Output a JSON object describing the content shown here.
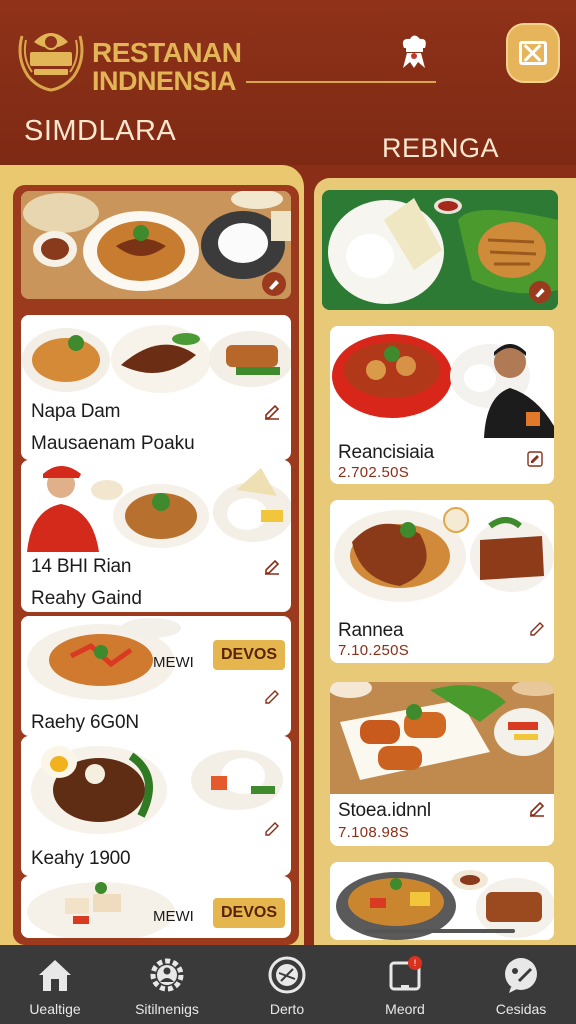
{
  "header": {
    "brand_line1": "RESTANAN",
    "brand_line2": "INDNENSIA",
    "tab_left": "SIMDLARA",
    "tab_right": "REBNGA"
  },
  "left_cards": [
    {
      "name": "Napa Dam",
      "subtitle": "Mausaenam Poaku"
    },
    {
      "name": "14 BHI Rian",
      "subtitle": "Reahy Gaind"
    },
    {
      "name": "Raehy 6G0N",
      "tag_small": "MEWI",
      "button": "DEVOS"
    },
    {
      "name": "Keahy 1900"
    },
    {
      "tag_small": "MEWI",
      "button": "DEVOS"
    }
  ],
  "right_cards": [
    {
      "name": "",
      "price": ""
    },
    {
      "name": "Reancisiaia",
      "price": "2.702.50S"
    },
    {
      "name": "Rannea",
      "price": "7.10.250S"
    },
    {
      "name": "Stoea.idnnl",
      "price": "7.108.98S"
    }
  ],
  "bottom_nav": [
    {
      "label": "Uealtige",
      "icon": "home-icon"
    },
    {
      "label": "Sitilnenigs",
      "icon": "settings-gear-icon"
    },
    {
      "label": "Derto",
      "icon": "plate-icon"
    },
    {
      "label": "Meord",
      "icon": "tablet-icon",
      "badge": "!"
    },
    {
      "label": "Cesidas",
      "icon": "chat-icon"
    }
  ],
  "colors": {
    "brand_red": "#8a2e18",
    "gold": "#e4b64d",
    "cream": "#e9c870",
    "nav_bg": "#3a3a3a"
  }
}
